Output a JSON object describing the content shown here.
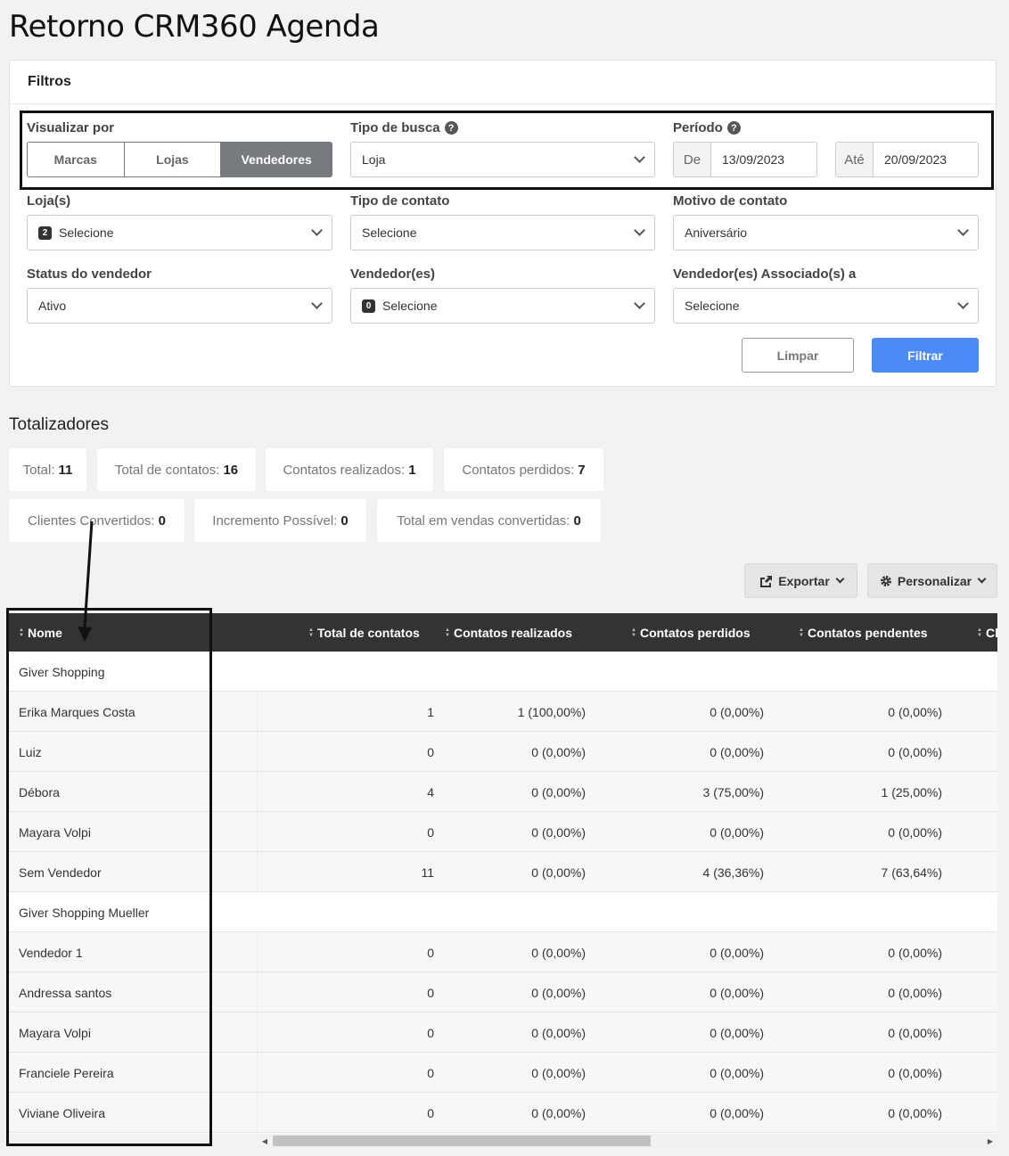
{
  "page_title": "Retorno CRM360 Agenda",
  "filters": {
    "title": "Filtros",
    "view_by": {
      "label": "Visualizar por",
      "options": [
        "Marcas",
        "Lojas",
        "Vendedores"
      ],
      "active": "Vendedores"
    },
    "search_type": {
      "label": "Tipo de busca",
      "value": "Loja"
    },
    "period": {
      "label": "Período",
      "from_label": "De",
      "from_value": "13/09/2023",
      "to_label": "Até",
      "to_value": "20/09/2023"
    },
    "stores": {
      "label": "Loja(s)",
      "count": "2",
      "value": "Selecione"
    },
    "contact_type": {
      "label": "Tipo de contato",
      "value": "Selecione"
    },
    "contact_reason": {
      "label": "Motivo de contato",
      "value": "Aniversário"
    },
    "seller_status": {
      "label": "Status do vendedor",
      "value": "Ativo"
    },
    "sellers": {
      "label": "Vendedor(es)",
      "count": "0",
      "value": "Selecione"
    },
    "associated_sellers": {
      "label": "Vendedor(es) Associado(s) a",
      "value": "Selecione"
    },
    "clear_label": "Limpar",
    "filter_label": "Filtrar"
  },
  "totals": {
    "title": "Totalizadores",
    "items": [
      {
        "label": "Total:",
        "value": "11"
      },
      {
        "label": "Total de contatos:",
        "value": "16"
      },
      {
        "label": "Contatos realizados:",
        "value": "1"
      },
      {
        "label": "Contatos perdidos:",
        "value": "7"
      },
      {
        "label": "Clientes Convertidos:",
        "value": "0"
      },
      {
        "label": "Incremento Possível:",
        "value": "0"
      },
      {
        "label": "Total em vendas convertidas:",
        "value": "0"
      }
    ]
  },
  "toolbar": {
    "export_label": "Exportar",
    "customize_label": "Personalizar"
  },
  "table": {
    "headers": [
      "Nome",
      "Total de contatos",
      "Contatos realizados",
      "Contatos perdidos",
      "Contatos pendentes",
      "Cl"
    ],
    "rows": [
      {
        "type": "group",
        "name": "Giver Shopping"
      },
      {
        "type": "data",
        "name": "Erika Marques Costa",
        "total": "1",
        "done": "1 (100,00%)",
        "lost": "0 (0,00%)",
        "pending": "0 (0,00%)"
      },
      {
        "type": "data",
        "name": "Luiz",
        "total": "0",
        "done": "0 (0,00%)",
        "lost": "0 (0,00%)",
        "pending": "0 (0,00%)"
      },
      {
        "type": "data",
        "name": "Débora",
        "total": "4",
        "done": "0 (0,00%)",
        "lost": "3 (75,00%)",
        "pending": "1 (25,00%)"
      },
      {
        "type": "data",
        "name": "Mayara Volpi",
        "total": "0",
        "done": "0 (0,00%)",
        "lost": "0 (0,00%)",
        "pending": "0 (0,00%)"
      },
      {
        "type": "data",
        "name": "Sem Vendedor",
        "total": "11",
        "done": "0 (0,00%)",
        "lost": "4 (36,36%)",
        "pending": "7 (63,64%)"
      },
      {
        "type": "group",
        "name": "Giver Shopping Mueller"
      },
      {
        "type": "data",
        "name": "Vendedor 1",
        "total": "0",
        "done": "0 (0,00%)",
        "lost": "0 (0,00%)",
        "pending": "0 (0,00%)"
      },
      {
        "type": "data",
        "name": "Andressa santos",
        "total": "0",
        "done": "0 (0,00%)",
        "lost": "0 (0,00%)",
        "pending": "0 (0,00%)"
      },
      {
        "type": "data",
        "name": "Mayara Volpi",
        "total": "0",
        "done": "0 (0,00%)",
        "lost": "0 (0,00%)",
        "pending": "0 (0,00%)"
      },
      {
        "type": "data",
        "name": "Franciele Pereira",
        "total": "0",
        "done": "0 (0,00%)",
        "lost": "0 (0,00%)",
        "pending": "0 (0,00%)"
      },
      {
        "type": "data",
        "name": "Viviane Oliveira",
        "total": "0",
        "done": "0 (0,00%)",
        "lost": "0 (0,00%)",
        "pending": "0 (0,00%)"
      }
    ]
  },
  "colors": {
    "primary": "#4a8bf5",
    "header_bg": "#333333",
    "segment_active": "#777b80"
  }
}
